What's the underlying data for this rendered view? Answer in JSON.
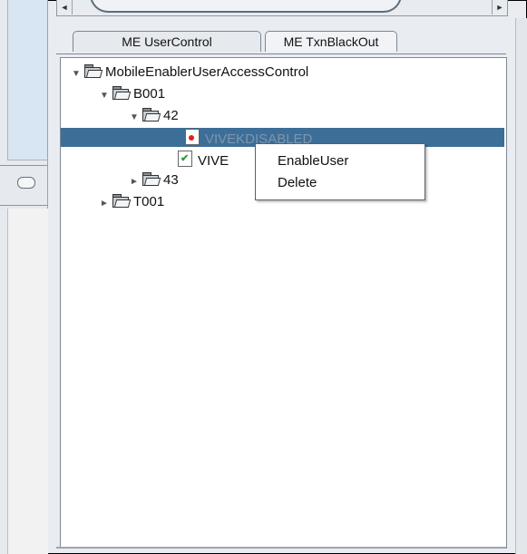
{
  "tabs": [
    {
      "label": "ME UserControl",
      "active": true
    },
    {
      "label": "ME TxnBlackOut",
      "active": false
    }
  ],
  "tree": {
    "root": {
      "label": "MobileEnablerUserAccessControl",
      "expanded": true
    },
    "b001": {
      "label": "B001",
      "expanded": true
    },
    "n42": {
      "label": "42",
      "expanded": true
    },
    "user_disabled": {
      "label": "VIVEKDISABLED",
      "icon": "disabled-user-icon",
      "selected": true
    },
    "user_enabled": {
      "label": "VIVE",
      "icon": "enabled-user-icon"
    },
    "n43": {
      "label": "43",
      "expanded": false
    },
    "t001": {
      "label": "T001",
      "expanded": false
    }
  },
  "context_menu": {
    "items": [
      "EnableUser",
      "Delete"
    ]
  },
  "scrollbar": {
    "left_arrow": "◄",
    "right_arrow": "►"
  },
  "colors": {
    "selection": "#3d6e97",
    "accent_left_pane": "#d8e5f3"
  }
}
